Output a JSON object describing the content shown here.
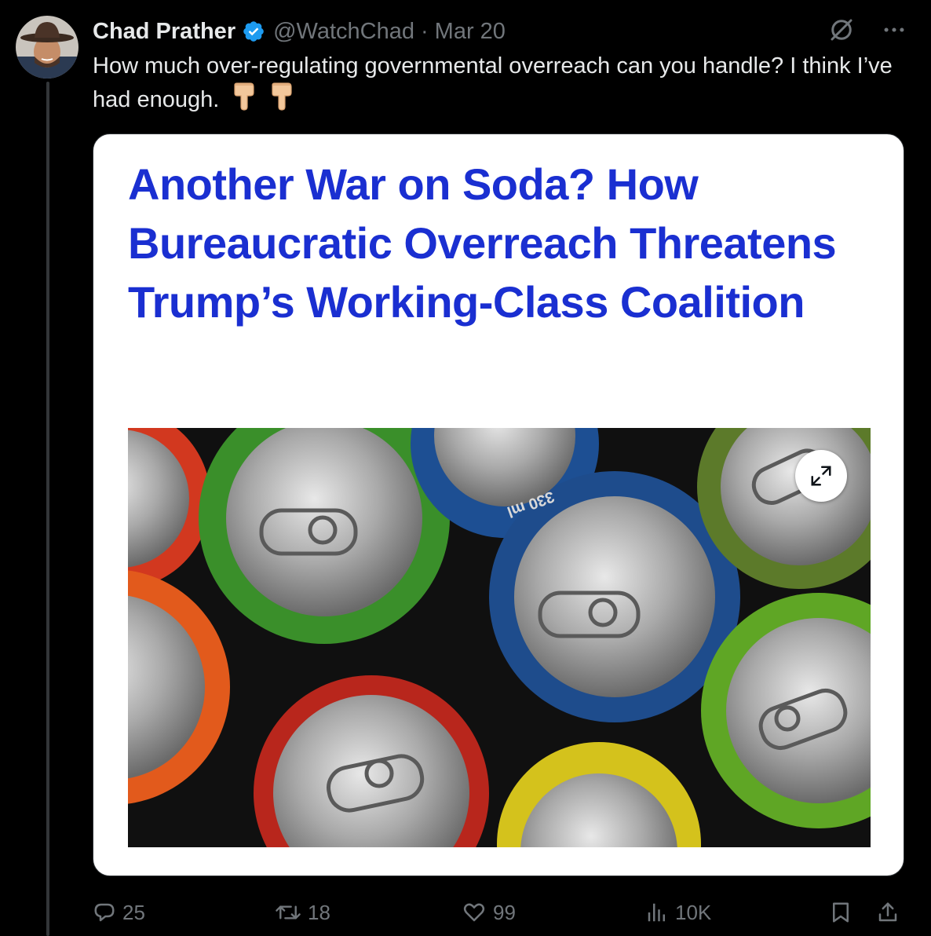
{
  "tweet": {
    "author_name": "Chad Prather",
    "handle": "@WatchChad",
    "separator": "·",
    "date": "Mar 20",
    "text": "How much over-regulating governmental overreach can you handle? I think I’ve had enough.",
    "emoji": [
      "backhand-index-pointing-down",
      "backhand-index-pointing-down"
    ],
    "verified": true
  },
  "card": {
    "headline": "Another War on Soda? How Bureaucratic Overreach Threatens Trump’s Working-Class Coalition",
    "image_subject": "overhead photo of soda cans",
    "can_label": "330 ml"
  },
  "actions": {
    "replies": "25",
    "reposts": "18",
    "likes": "99",
    "views": "10K"
  },
  "icons": {
    "verified": "verified-badge-icon",
    "grok": "grok-icon",
    "more": "more-icon",
    "reply": "reply-icon",
    "repost": "repost-icon",
    "like": "heart-icon",
    "views": "views-icon",
    "bookmark": "bookmark-icon",
    "share": "share-icon",
    "expand": "expand-icon"
  },
  "colors": {
    "background": "#000000",
    "text": "#e7e9ea",
    "muted": "#71767b",
    "verified": "#1d9bf0",
    "headline": "#1a2fd1"
  }
}
